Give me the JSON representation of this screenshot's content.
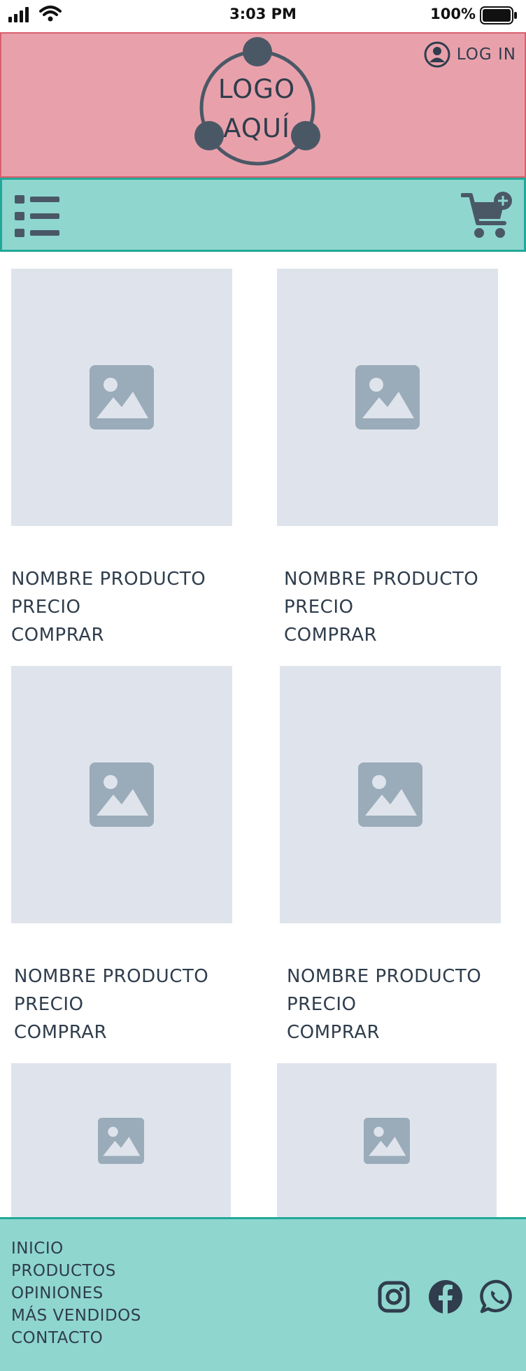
{
  "status_bar": {
    "time": "3:03 PM",
    "battery_percent": "100%"
  },
  "header": {
    "logo_line1": "LOGO",
    "logo_line2": "AQUÍ",
    "login_label": "LOG IN",
    "login_icon": "user-circle-icon"
  },
  "nav": {
    "menu_icon": "list-menu-icon",
    "cart_icon": "cart-add-icon"
  },
  "products": [
    {
      "name": "NOMBRE PRODUCTO",
      "price": "PRECIO",
      "buy": "COMPRAR"
    },
    {
      "name": "NOMBRE PRODUCTO",
      "price": "PRECIO",
      "buy": "COMPRAR"
    },
    {
      "name": "NOMBRE PRODUCTO",
      "price": "PRECIO",
      "buy": "COMPRAR"
    },
    {
      "name": "NOMBRE PRODUCTO",
      "price": "PRECIO",
      "buy": "COMPRAR"
    },
    {
      "name": "",
      "price": "",
      "buy": ""
    },
    {
      "name": "",
      "price": "",
      "buy": ""
    }
  ],
  "footer": {
    "links": [
      "INICIO",
      "PRODUCTOS",
      "OPINIONES",
      "MÁS VENDIDOS",
      "CONTACTO"
    ],
    "social": [
      "instagram-icon",
      "facebook-icon",
      "whatsapp-icon"
    ]
  },
  "colors": {
    "header_bg": "#e8a1ab",
    "header_border": "#d9606f",
    "nav_bg": "#8fd6cf",
    "nav_border": "#21a898",
    "placeholder_bg": "#dfe4ec",
    "placeholder_icon": "#9aabb9",
    "text": "#2f3d4c"
  }
}
